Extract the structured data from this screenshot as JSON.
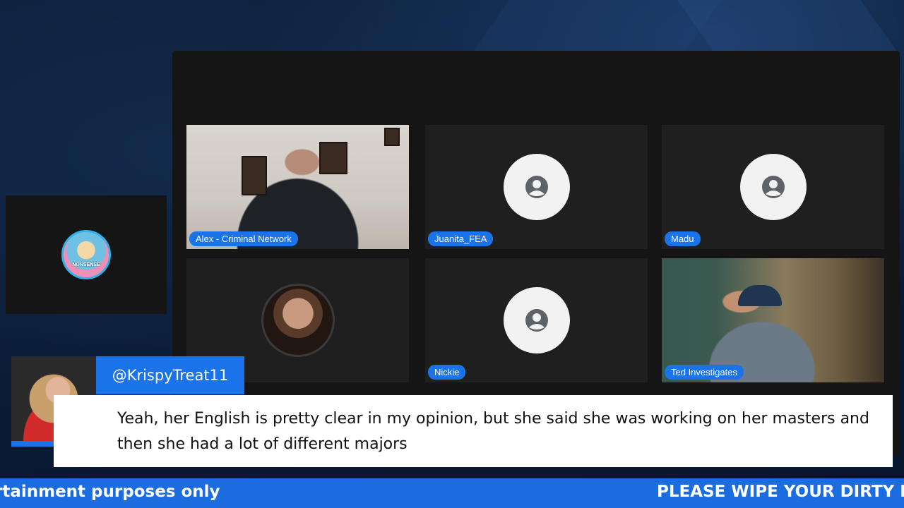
{
  "participants": [
    {
      "name": "Alex - Criminal Network",
      "video": true
    },
    {
      "name": "Juanita_FEA",
      "video": false
    },
    {
      "name": "Madu",
      "video": false
    },
    {
      "name": "",
      "video": false
    },
    {
      "name": "Nickie",
      "video": false
    },
    {
      "name": "Ted Investigates",
      "video": true
    }
  ],
  "side_tile": {
    "logo_text": "NONSENSE"
  },
  "comment": {
    "username": "@KrispyTreat11",
    "text": "Yeah, her English is pretty clear in my opinion, but she said she was working on her masters and then she had a lot of different majors",
    "platform_icon": "youtube-icon"
  },
  "ticker": {
    "left_text": "rtainment purposes only",
    "right_text": "PLEASE WIPE YOUR DIRTY F"
  },
  "colors": {
    "accent": "#1a73e8",
    "ticker": "#1b6ddf",
    "tile_bg": "#1f1f1f"
  }
}
